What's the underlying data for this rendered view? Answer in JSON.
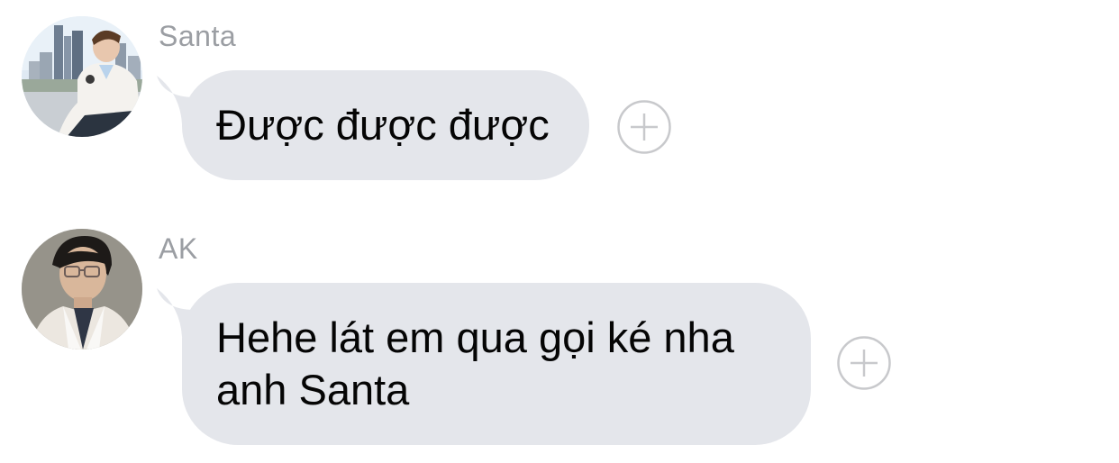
{
  "messages": [
    {
      "sender": "Santa",
      "text": "Được được được",
      "avatar_icon": "person-avatar-city-background"
    },
    {
      "sender": "AK",
      "text": "Hehe lát em qua gọi ké nha anh Santa",
      "avatar_icon": "person-avatar-glasses"
    }
  ],
  "colors": {
    "bubble_background": "#e4e6eb",
    "sender_name": "#9b9ea3",
    "message_text": "#050505",
    "react_icon": "#c8c9cc"
  },
  "icons": {
    "react": "add-reaction-plus-icon"
  }
}
